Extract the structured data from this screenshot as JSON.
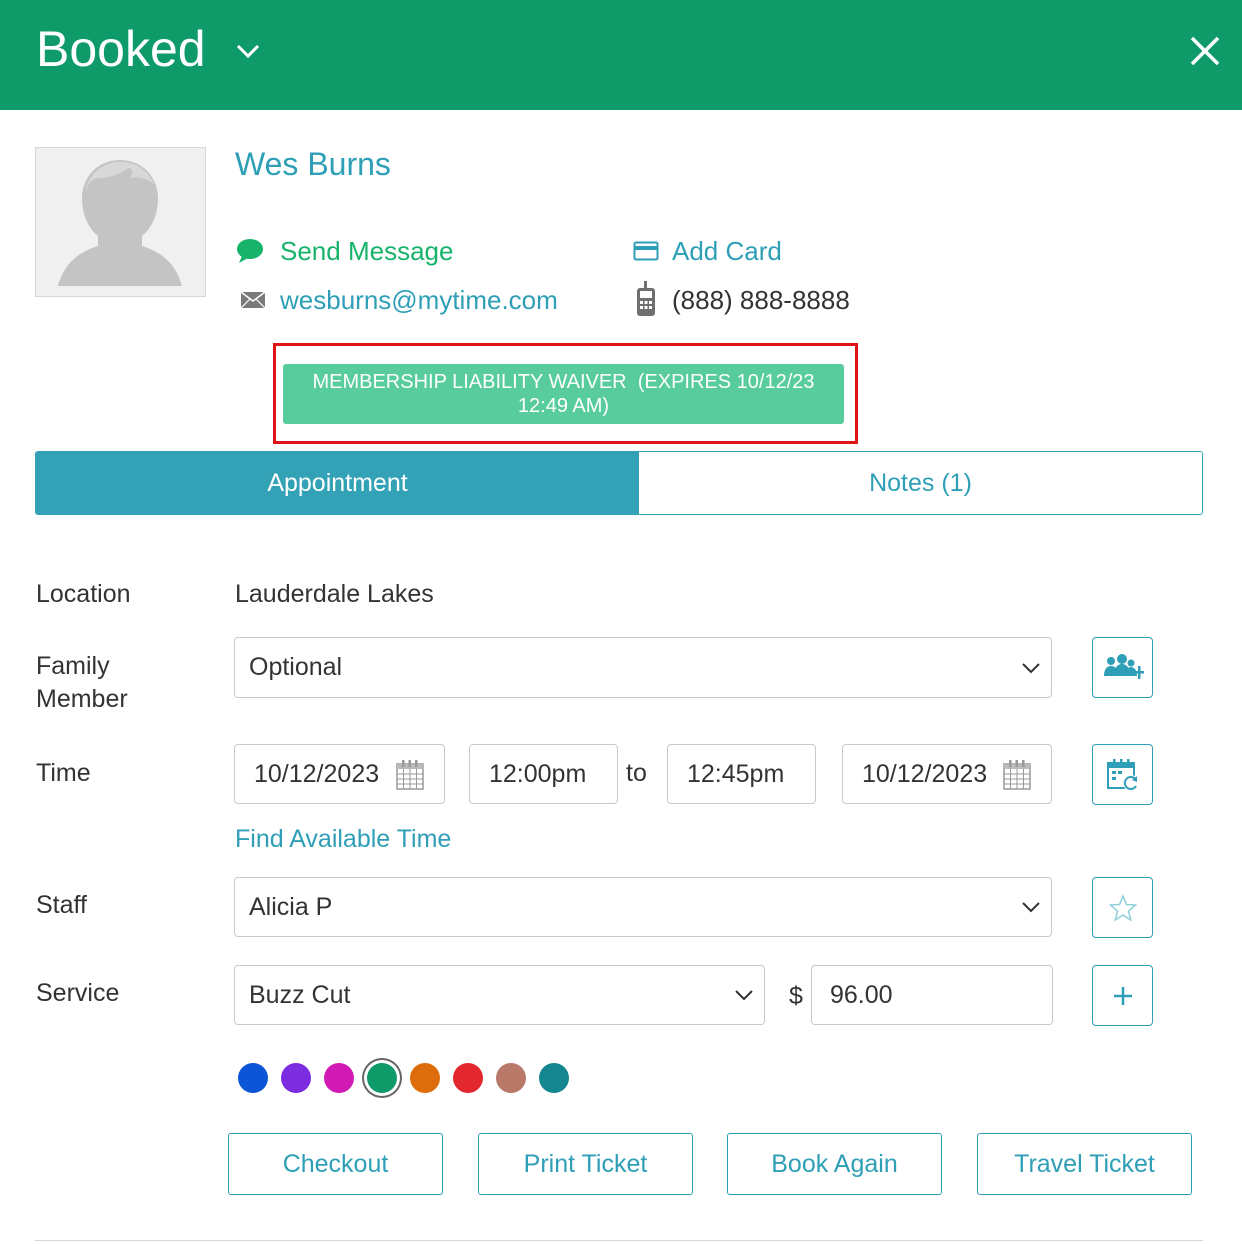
{
  "header": {
    "title": "Booked",
    "bg_color": "#0e9b69"
  },
  "client": {
    "name": "Wes Burns",
    "send_message": "Send Message",
    "email": "wesburns@mytime.com",
    "add_card": "Add Card",
    "phone": "(888) 888-8888"
  },
  "waiver": {
    "line1": "MEMBERSHIP LIABILITY WAIVER  (EXPIRES 10/12/23",
    "line2": "12:49 AM)"
  },
  "tabs": [
    {
      "label": "Appointment",
      "active": true
    },
    {
      "label": "Notes (1)",
      "active": false
    }
  ],
  "form": {
    "location_label": "Location",
    "location_value": "Lauderdale Lakes",
    "family_label_1": "Family",
    "family_label_2": "Member",
    "family_value": "Optional",
    "time_label": "Time",
    "start_date": "10/12/2023",
    "start_time": "12:00pm",
    "to_label": "to",
    "end_time": "12:45pm",
    "end_date": "10/12/2023",
    "find_time": "Find Available Time",
    "staff_label": "Staff",
    "staff_value": "Alicia P",
    "service_label": "Service",
    "service_value": "Buzz Cut",
    "currency": "$",
    "price": "96.00"
  },
  "colors": [
    {
      "hex": "#0b55d6",
      "selected": false
    },
    {
      "hex": "#7c2de0",
      "selected": false
    },
    {
      "hex": "#d119b3",
      "selected": false
    },
    {
      "hex": "#0e9b69",
      "selected": true
    },
    {
      "hex": "#dd6d0b",
      "selected": false
    },
    {
      "hex": "#e2282e",
      "selected": false
    },
    {
      "hex": "#b97969",
      "selected": false
    },
    {
      "hex": "#14868f",
      "selected": false
    }
  ],
  "actions": {
    "checkout": "Checkout",
    "print_ticket": "Print Ticket",
    "book_again": "Book Again",
    "travel_ticket": "Travel Ticket"
  }
}
